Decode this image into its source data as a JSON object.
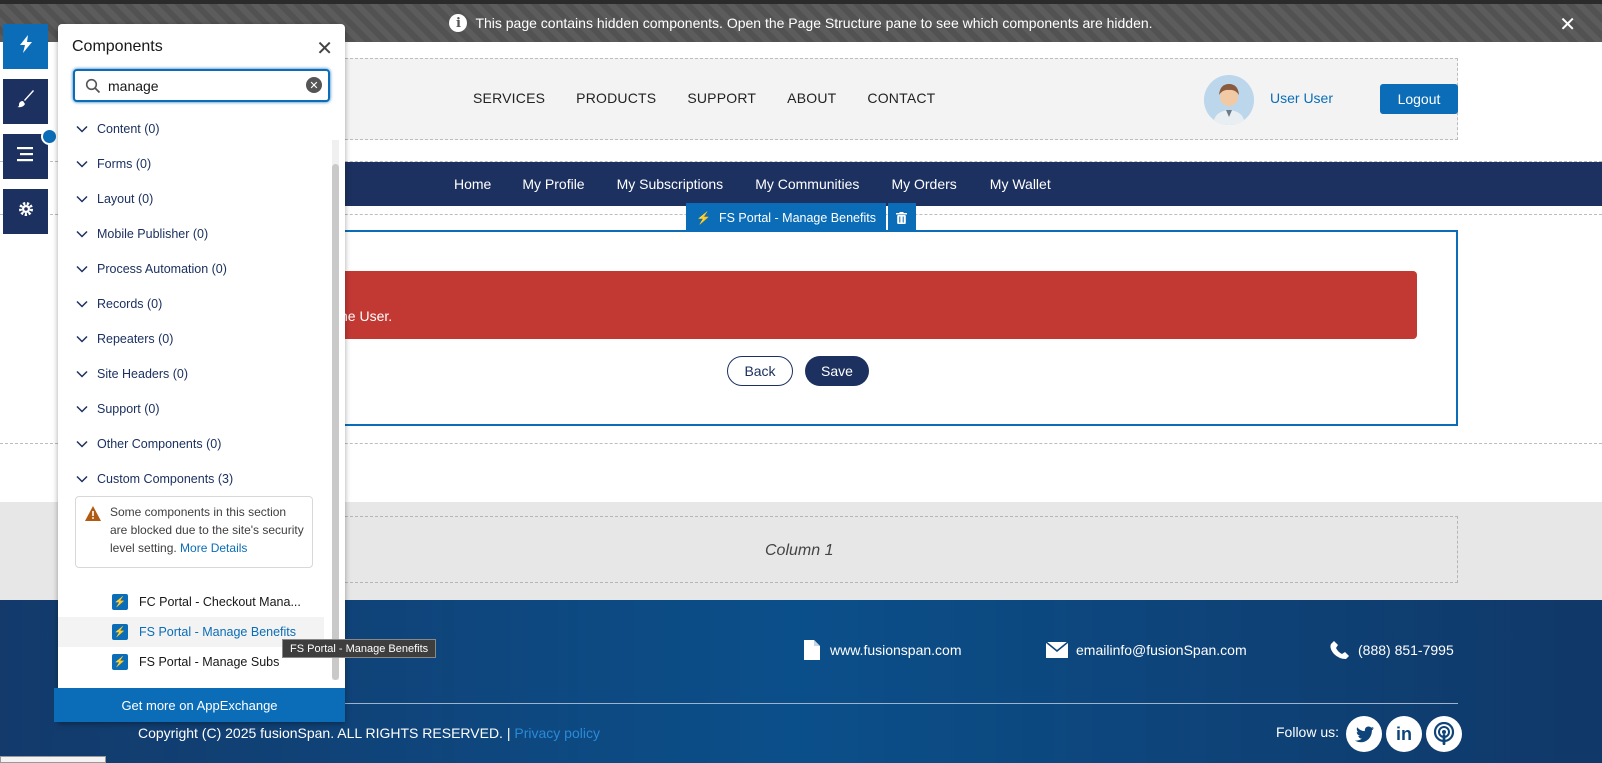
{
  "banner": {
    "message": "This page contains hidden components. Open the Page Structure pane to see which components are hidden.",
    "info_icon": "info-icon",
    "close_icon": "close-icon"
  },
  "header": {
    "nav": [
      "SERVICES",
      "PRODUCTS",
      "SUPPORT",
      "ABOUT",
      "CONTACT"
    ],
    "user_name": "User User",
    "logout_label": "Logout"
  },
  "navbar": {
    "items": [
      "Home",
      "My Profile",
      "My Subscriptions",
      "My Communities",
      "My Orders",
      "My Wallet"
    ]
  },
  "selected_component": {
    "label": "FS Portal - Manage Benefits",
    "error_text": "he User.",
    "back_label": "Back",
    "save_label": "Save"
  },
  "column": {
    "label": "Column 1"
  },
  "footer": {
    "website": "www.fusionspan.com",
    "email": "emailinfo@fusionSpan.com",
    "phone": "(888) 851-7995",
    "copyright": "Copyright (C) 2025 fusionSpan. ALL RIGHTS RESERVED. |",
    "privacy": "Privacy policy",
    "follow": "Follow us:"
  },
  "panel": {
    "title": "Components",
    "search_value": "manage",
    "categories": [
      "Content (0)",
      "Forms (0)",
      "Layout (0)",
      "Mobile Publisher (0)",
      "Process Automation (0)",
      "Records (0)",
      "Repeaters (0)",
      "Site Headers (0)",
      "Support (0)",
      "Other Components (0)",
      "Custom Components (3)"
    ],
    "warning_text": "Some components in this section are blocked due to the site's security level setting.",
    "warning_link": "More Details",
    "components": [
      "FC Portal - Checkout Mana...",
      "FS Portal - Manage Benefits",
      "FS Portal - Manage Subs"
    ],
    "tooltip": "FS Portal - Manage Benefits",
    "appexchange": "Get more on AppExchange"
  },
  "colors": {
    "brand_blue": "#0b6db7",
    "navy": "#1c3160",
    "error_red": "#c23934"
  }
}
